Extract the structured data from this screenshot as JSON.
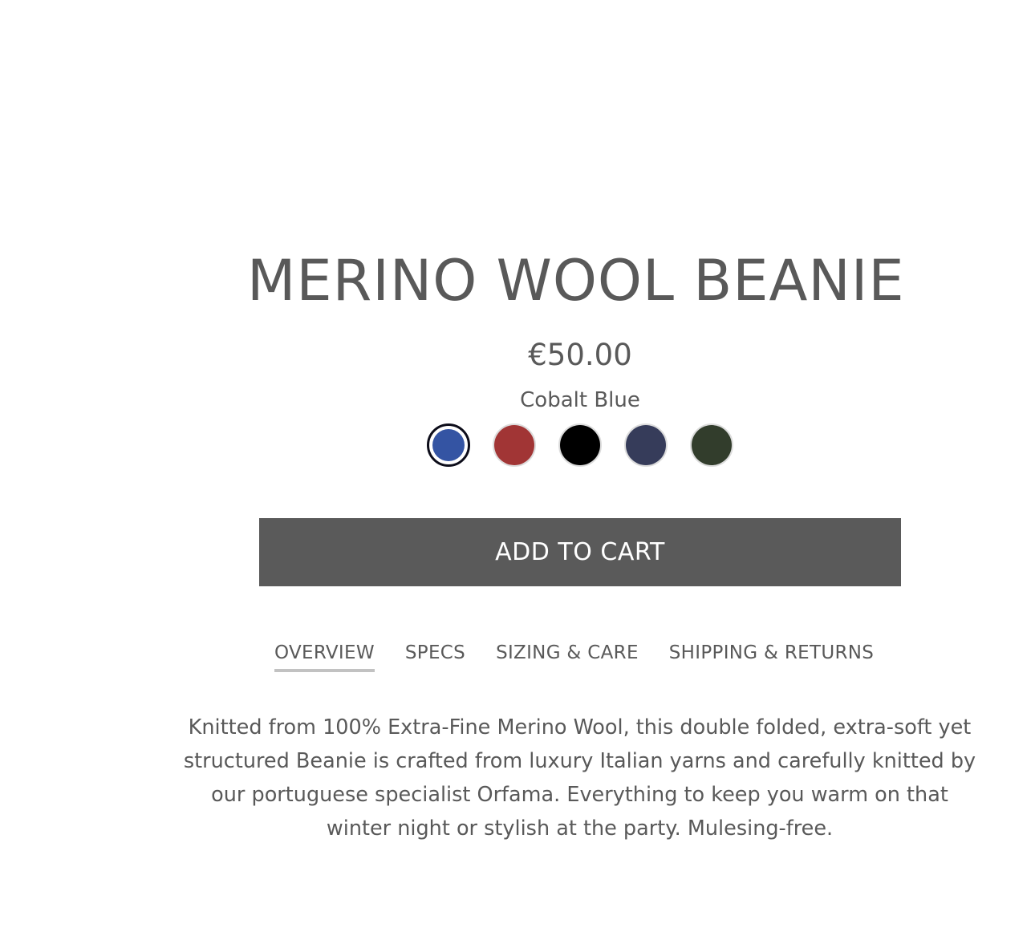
{
  "product": {
    "title": "MERINO WOOL BEANIE",
    "price": "€50.00",
    "selected_color": "Cobalt Blue",
    "swatches": [
      {
        "name": "Cobalt Blue",
        "color": "#3454a3",
        "selected": true
      },
      {
        "name": "Red",
        "color": "#a13535",
        "selected": false
      },
      {
        "name": "Black",
        "color": "#000000",
        "selected": false
      },
      {
        "name": "Navy",
        "color": "#363c5a",
        "selected": false
      },
      {
        "name": "Green",
        "color": "#323d2c",
        "selected": false
      }
    ],
    "add_to_cart_label": "ADD TO CART",
    "tabs": [
      {
        "label": "OVERVIEW",
        "active": true
      },
      {
        "label": "SPECS",
        "active": false
      },
      {
        "label": "SIZING & CARE",
        "active": false
      },
      {
        "label": "SHIPPING & RETURNS",
        "active": false
      }
    ],
    "description": "Knitted from 100% Extra-Fine Merino Wool, this double folded, extra-soft yet structured Beanie is crafted from luxury Italian yarns and carefully knitted by our portuguese specialist Orfama. Everything to keep you warm on that winter night or stylish at the party. Mulesing-free."
  },
  "colors": {
    "text": "#595959",
    "button_bg": "#5a5a5a",
    "button_text": "#ffffff",
    "tab_underline": "#c2c2c2"
  }
}
